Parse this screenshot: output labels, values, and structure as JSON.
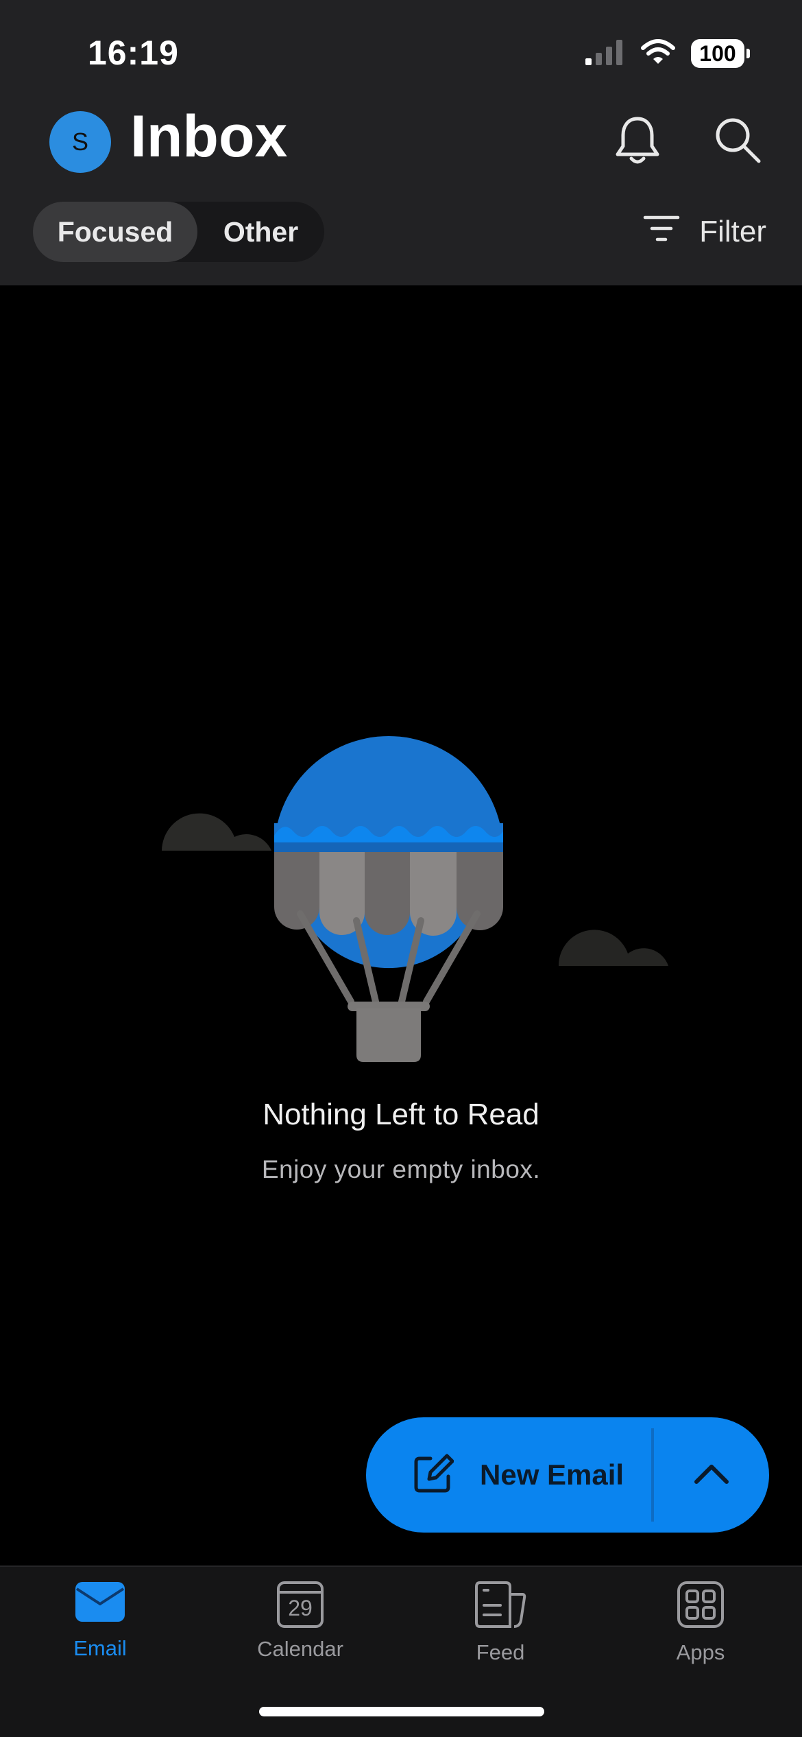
{
  "status_bar": {
    "time": "16:19",
    "battery": "100"
  },
  "header": {
    "avatar_initial": "S",
    "title": "Inbox",
    "tabs": [
      {
        "label": "Focused",
        "active": true
      },
      {
        "label": "Other",
        "active": false
      }
    ],
    "filter_label": "Filter"
  },
  "empty_state": {
    "title": "Nothing Left to Read",
    "subtitle": "Enjoy your empty inbox."
  },
  "fab": {
    "label": "New Email"
  },
  "bottom_nav": {
    "items": [
      {
        "label": "Email",
        "active": true
      },
      {
        "label": "Calendar",
        "active": false,
        "badge": "29"
      },
      {
        "label": "Feed",
        "active": false
      },
      {
        "label": "Apps",
        "active": false
      }
    ]
  },
  "colors": {
    "accent": "#0a84ef",
    "header_bg": "#222224",
    "tabbar_bg": "#151516",
    "balloon_blue": "#1a75cf"
  }
}
